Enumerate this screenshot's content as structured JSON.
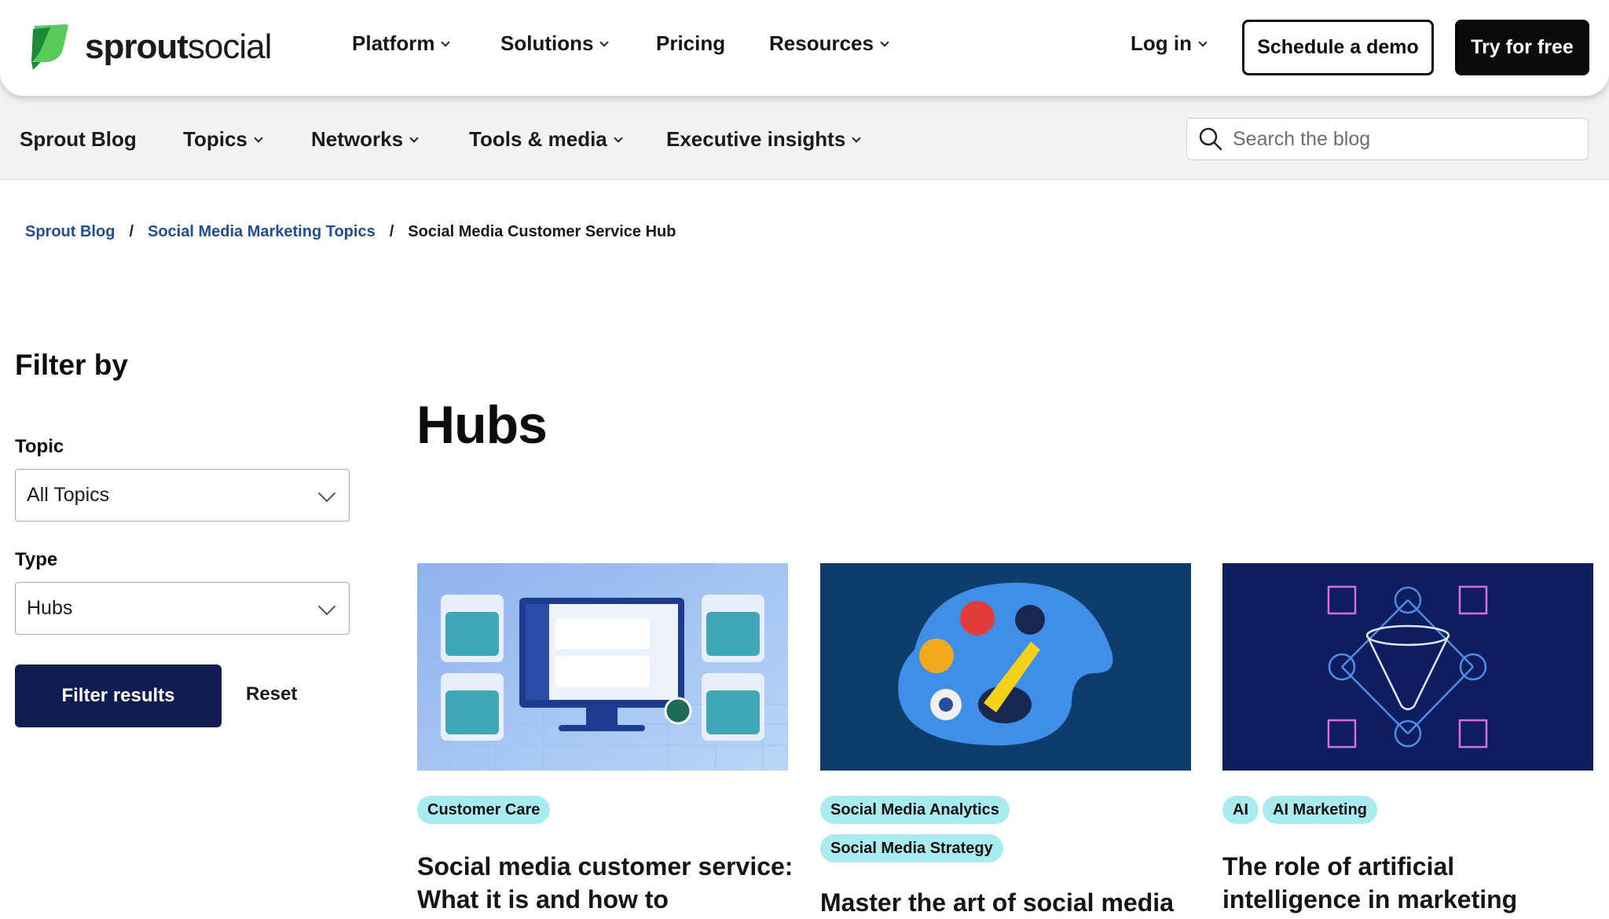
{
  "brand": {
    "name_bold": "sprout",
    "name_light": "social"
  },
  "topnav": {
    "items": [
      "Platform",
      "Solutions",
      "Pricing",
      "Resources"
    ],
    "login": "Log in",
    "demo_button": "Schedule a demo",
    "trial_button": "Try for free"
  },
  "subnav": {
    "home": "Sprout Blog",
    "items": [
      "Topics",
      "Networks",
      "Tools & media",
      "Executive insights"
    ],
    "search_placeholder": "Search the blog"
  },
  "breadcrumb": {
    "items": [
      "Sprout Blog",
      "Social Media Marketing Topics"
    ],
    "current": "Social Media Customer Service Hub",
    "separator": "/"
  },
  "filter": {
    "title": "Filter by",
    "topic_label": "Topic",
    "topic_value": "All Topics",
    "type_label": "Type",
    "type_value": "Hubs",
    "submit": "Filter results",
    "reset": "Reset"
  },
  "main": {
    "title": "Hubs",
    "cards": [
      {
        "tags": [
          "Customer Care"
        ],
        "title": "Social media customer service: What it is and how to"
      },
      {
        "tags": [
          "Social Media Analytics",
          "Social Media Strategy"
        ],
        "title": "Master the art of social media"
      },
      {
        "tags": [
          "AI",
          "AI Marketing"
        ],
        "title": "The role of artificial intelligence in marketing"
      }
    ]
  },
  "colors": {
    "accent_navy": "#101c50",
    "link_blue": "#1d4f91",
    "tag_bg": "#a9ecf0",
    "brand_green": "#59cb59"
  }
}
